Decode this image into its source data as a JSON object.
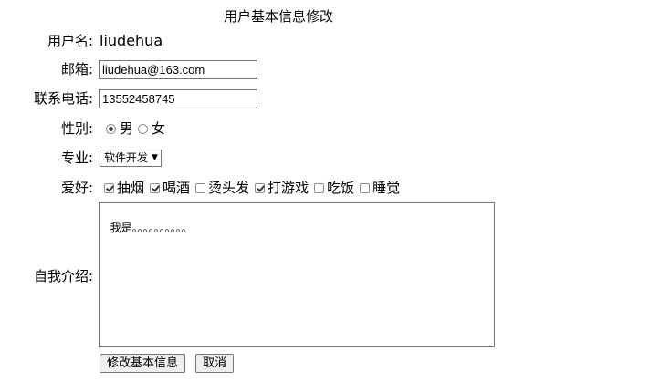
{
  "title": "用户基本信息修改",
  "fields": {
    "username": {
      "label": "用户名:",
      "value": "liudehua"
    },
    "email": {
      "label": "邮箱:",
      "value": "liudehua@163.com"
    },
    "phone": {
      "label": "联系电话:",
      "value": "13552458745"
    },
    "gender": {
      "label": "性别:",
      "options": [
        {
          "label": "男",
          "checked": true
        },
        {
          "label": "女",
          "checked": false
        }
      ]
    },
    "major": {
      "label": "专业:",
      "selected": "软件开发"
    },
    "hobbies": {
      "label": "爱好:",
      "options": [
        {
          "label": "抽烟",
          "checked": true
        },
        {
          "label": "喝酒",
          "checked": true
        },
        {
          "label": "烫头发",
          "checked": false
        },
        {
          "label": "打游戏",
          "checked": true
        },
        {
          "label": "吃饭",
          "checked": false
        },
        {
          "label": "睡觉",
          "checked": false
        }
      ]
    },
    "intro": {
      "label": "自我介绍:",
      "value": "我是。。。。。。。。。。"
    }
  },
  "buttons": {
    "submit": "修改基本信息",
    "cancel": "取消"
  }
}
